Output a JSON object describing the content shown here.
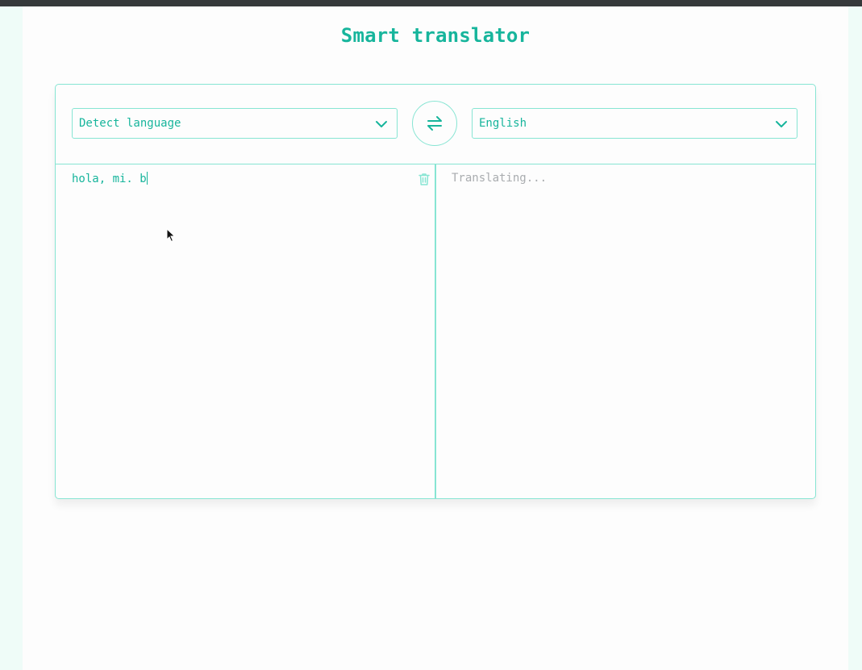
{
  "app": {
    "title": "Smart translator"
  },
  "source_language": {
    "selected": "Detect language"
  },
  "target_language": {
    "selected": "English"
  },
  "source_text": {
    "value": "hola, mi. b"
  },
  "output": {
    "status": "Translating..."
  },
  "icons": {
    "swap": "swap-arrows-icon",
    "delete": "trash-icon",
    "dropdown": "chevron-down-icon"
  },
  "colors": {
    "accent": "#17b59c",
    "border": "#87e5d3",
    "background": "#effcf8",
    "placeholder": "#a9acaf"
  }
}
